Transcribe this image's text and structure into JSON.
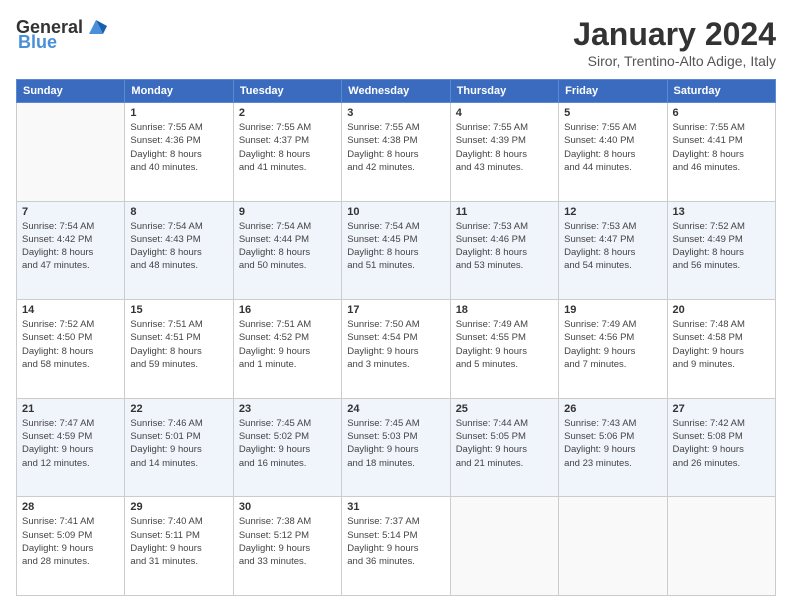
{
  "header": {
    "logo_general": "General",
    "logo_blue": "Blue",
    "month": "January 2024",
    "location": "Siror, Trentino-Alto Adige, Italy"
  },
  "weekdays": [
    "Sunday",
    "Monday",
    "Tuesday",
    "Wednesday",
    "Thursday",
    "Friday",
    "Saturday"
  ],
  "weeks": [
    [
      {
        "day": "",
        "info": ""
      },
      {
        "day": "1",
        "info": "Sunrise: 7:55 AM\nSunset: 4:36 PM\nDaylight: 8 hours\nand 40 minutes."
      },
      {
        "day": "2",
        "info": "Sunrise: 7:55 AM\nSunset: 4:37 PM\nDaylight: 8 hours\nand 41 minutes."
      },
      {
        "day": "3",
        "info": "Sunrise: 7:55 AM\nSunset: 4:38 PM\nDaylight: 8 hours\nand 42 minutes."
      },
      {
        "day": "4",
        "info": "Sunrise: 7:55 AM\nSunset: 4:39 PM\nDaylight: 8 hours\nand 43 minutes."
      },
      {
        "day": "5",
        "info": "Sunrise: 7:55 AM\nSunset: 4:40 PM\nDaylight: 8 hours\nand 44 minutes."
      },
      {
        "day": "6",
        "info": "Sunrise: 7:55 AM\nSunset: 4:41 PM\nDaylight: 8 hours\nand 46 minutes."
      }
    ],
    [
      {
        "day": "7",
        "info": "Sunrise: 7:54 AM\nSunset: 4:42 PM\nDaylight: 8 hours\nand 47 minutes."
      },
      {
        "day": "8",
        "info": "Sunrise: 7:54 AM\nSunset: 4:43 PM\nDaylight: 8 hours\nand 48 minutes."
      },
      {
        "day": "9",
        "info": "Sunrise: 7:54 AM\nSunset: 4:44 PM\nDaylight: 8 hours\nand 50 minutes."
      },
      {
        "day": "10",
        "info": "Sunrise: 7:54 AM\nSunset: 4:45 PM\nDaylight: 8 hours\nand 51 minutes."
      },
      {
        "day": "11",
        "info": "Sunrise: 7:53 AM\nSunset: 4:46 PM\nDaylight: 8 hours\nand 53 minutes."
      },
      {
        "day": "12",
        "info": "Sunrise: 7:53 AM\nSunset: 4:47 PM\nDaylight: 8 hours\nand 54 minutes."
      },
      {
        "day": "13",
        "info": "Sunrise: 7:52 AM\nSunset: 4:49 PM\nDaylight: 8 hours\nand 56 minutes."
      }
    ],
    [
      {
        "day": "14",
        "info": "Sunrise: 7:52 AM\nSunset: 4:50 PM\nDaylight: 8 hours\nand 58 minutes."
      },
      {
        "day": "15",
        "info": "Sunrise: 7:51 AM\nSunset: 4:51 PM\nDaylight: 8 hours\nand 59 minutes."
      },
      {
        "day": "16",
        "info": "Sunrise: 7:51 AM\nSunset: 4:52 PM\nDaylight: 9 hours\nand 1 minute."
      },
      {
        "day": "17",
        "info": "Sunrise: 7:50 AM\nSunset: 4:54 PM\nDaylight: 9 hours\nand 3 minutes."
      },
      {
        "day": "18",
        "info": "Sunrise: 7:49 AM\nSunset: 4:55 PM\nDaylight: 9 hours\nand 5 minutes."
      },
      {
        "day": "19",
        "info": "Sunrise: 7:49 AM\nSunset: 4:56 PM\nDaylight: 9 hours\nand 7 minutes."
      },
      {
        "day": "20",
        "info": "Sunrise: 7:48 AM\nSunset: 4:58 PM\nDaylight: 9 hours\nand 9 minutes."
      }
    ],
    [
      {
        "day": "21",
        "info": "Sunrise: 7:47 AM\nSunset: 4:59 PM\nDaylight: 9 hours\nand 12 minutes."
      },
      {
        "day": "22",
        "info": "Sunrise: 7:46 AM\nSunset: 5:01 PM\nDaylight: 9 hours\nand 14 minutes."
      },
      {
        "day": "23",
        "info": "Sunrise: 7:45 AM\nSunset: 5:02 PM\nDaylight: 9 hours\nand 16 minutes."
      },
      {
        "day": "24",
        "info": "Sunrise: 7:45 AM\nSunset: 5:03 PM\nDaylight: 9 hours\nand 18 minutes."
      },
      {
        "day": "25",
        "info": "Sunrise: 7:44 AM\nSunset: 5:05 PM\nDaylight: 9 hours\nand 21 minutes."
      },
      {
        "day": "26",
        "info": "Sunrise: 7:43 AM\nSunset: 5:06 PM\nDaylight: 9 hours\nand 23 minutes."
      },
      {
        "day": "27",
        "info": "Sunrise: 7:42 AM\nSunset: 5:08 PM\nDaylight: 9 hours\nand 26 minutes."
      }
    ],
    [
      {
        "day": "28",
        "info": "Sunrise: 7:41 AM\nSunset: 5:09 PM\nDaylight: 9 hours\nand 28 minutes."
      },
      {
        "day": "29",
        "info": "Sunrise: 7:40 AM\nSunset: 5:11 PM\nDaylight: 9 hours\nand 31 minutes."
      },
      {
        "day": "30",
        "info": "Sunrise: 7:38 AM\nSunset: 5:12 PM\nDaylight: 9 hours\nand 33 minutes."
      },
      {
        "day": "31",
        "info": "Sunrise: 7:37 AM\nSunset: 5:14 PM\nDaylight: 9 hours\nand 36 minutes."
      },
      {
        "day": "",
        "info": ""
      },
      {
        "day": "",
        "info": ""
      },
      {
        "day": "",
        "info": ""
      }
    ]
  ]
}
